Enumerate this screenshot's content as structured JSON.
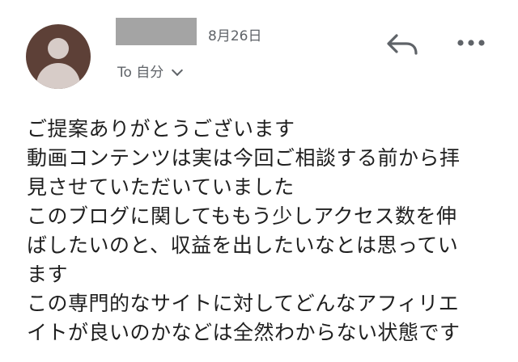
{
  "email": {
    "date": "8月26日",
    "recipient_label": "To 自分",
    "body_lines": [
      "ご提案ありがとうございます",
      "動画コンテンツは実は今回ご相談する前から拝",
      "見させていただいていました",
      "このブログに関してももう少しアクセス数を伸",
      "ばしたいのと、収益を出したいなとは思ってい",
      "ます",
      "この専門的なサイトに対してどんなアフィリエ",
      "イトが良いのかなどは全然わからない状態です"
    ]
  },
  "icons": {
    "avatar": "avatar-icon",
    "reply": "reply-icon",
    "more": "more-vert-icon",
    "expand": "chevron-down-icon"
  },
  "colors": {
    "avatar_bg": "#5d4037",
    "avatar_fg": "#d7ccc8",
    "redaction": "#a4a4a4",
    "secondary_text": "#5f6368"
  }
}
